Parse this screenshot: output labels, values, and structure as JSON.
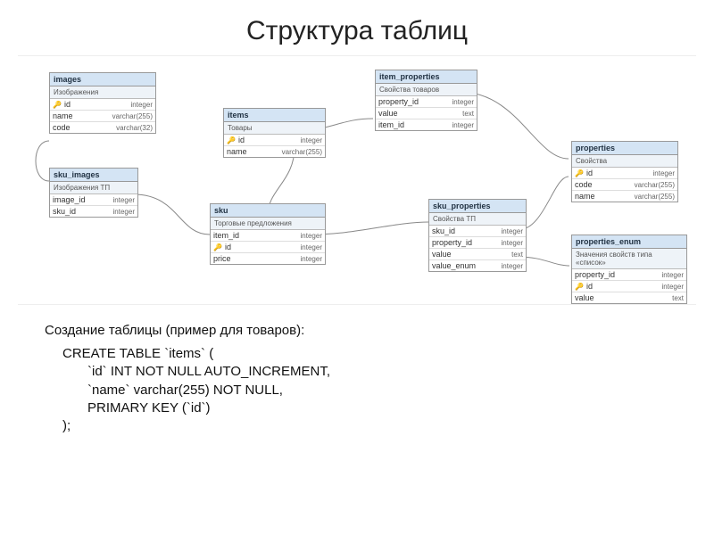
{
  "title": "Структура таблиц",
  "caption": "Создание таблицы (пример для товаров):",
  "sql": {
    "l1": "CREATE TABLE `items` (",
    "l2": "`id` INT NOT NULL AUTO_INCREMENT,",
    "l3": "`name` varchar(255) NOT NULL,",
    "l4": "PRIMARY KEY (`id`)",
    "l5": ");"
  },
  "tables": {
    "images": {
      "name": "images",
      "sub": "Изображения",
      "rows": [
        {
          "key": true,
          "col": "id",
          "type": "integer"
        },
        {
          "key": false,
          "col": "name",
          "type": "varchar(255)"
        },
        {
          "key": false,
          "col": "code",
          "type": "varchar(32)"
        }
      ]
    },
    "sku_images": {
      "name": "sku_images",
      "sub": "Изображения ТП",
      "rows": [
        {
          "key": false,
          "col": "image_id",
          "type": "integer"
        },
        {
          "key": false,
          "col": "sku_id",
          "type": "integer"
        }
      ]
    },
    "items": {
      "name": "items",
      "sub": "Товары",
      "rows": [
        {
          "key": true,
          "col": "id",
          "type": "integer"
        },
        {
          "key": false,
          "col": "name",
          "type": "varchar(255)"
        }
      ]
    },
    "sku": {
      "name": "sku",
      "sub": "Торговые предложения",
      "rows": [
        {
          "key": false,
          "col": "item_id",
          "type": "integer"
        },
        {
          "key": true,
          "col": "id",
          "type": "integer"
        },
        {
          "key": false,
          "col": "price",
          "type": "integer"
        }
      ]
    },
    "item_properties": {
      "name": "item_properties",
      "sub": "Свойства товаров",
      "rows": [
        {
          "key": false,
          "col": "property_id",
          "type": "integer"
        },
        {
          "key": false,
          "col": "value",
          "type": "text"
        },
        {
          "key": false,
          "col": "item_id",
          "type": "integer"
        }
      ]
    },
    "sku_properties": {
      "name": "sku_properties",
      "sub": "Свойства ТП",
      "rows": [
        {
          "key": false,
          "col": "sku_id",
          "type": "integer"
        },
        {
          "key": false,
          "col": "property_id",
          "type": "integer"
        },
        {
          "key": false,
          "col": "value",
          "type": "text"
        },
        {
          "key": false,
          "col": "value_enum",
          "type": "integer"
        }
      ]
    },
    "properties": {
      "name": "properties",
      "sub": "Свойства",
      "rows": [
        {
          "key": true,
          "col": "id",
          "type": "integer"
        },
        {
          "key": false,
          "col": "code",
          "type": "varchar(255)"
        },
        {
          "key": false,
          "col": "name",
          "type": "varchar(255)"
        }
      ]
    },
    "properties_enum": {
      "name": "properties_enum",
      "sub": "Значения свойств типа «список»",
      "rows": [
        {
          "key": false,
          "col": "property_id",
          "type": "integer"
        },
        {
          "key": true,
          "col": "id",
          "type": "integer"
        },
        {
          "key": false,
          "col": "value",
          "type": "text"
        }
      ]
    }
  }
}
